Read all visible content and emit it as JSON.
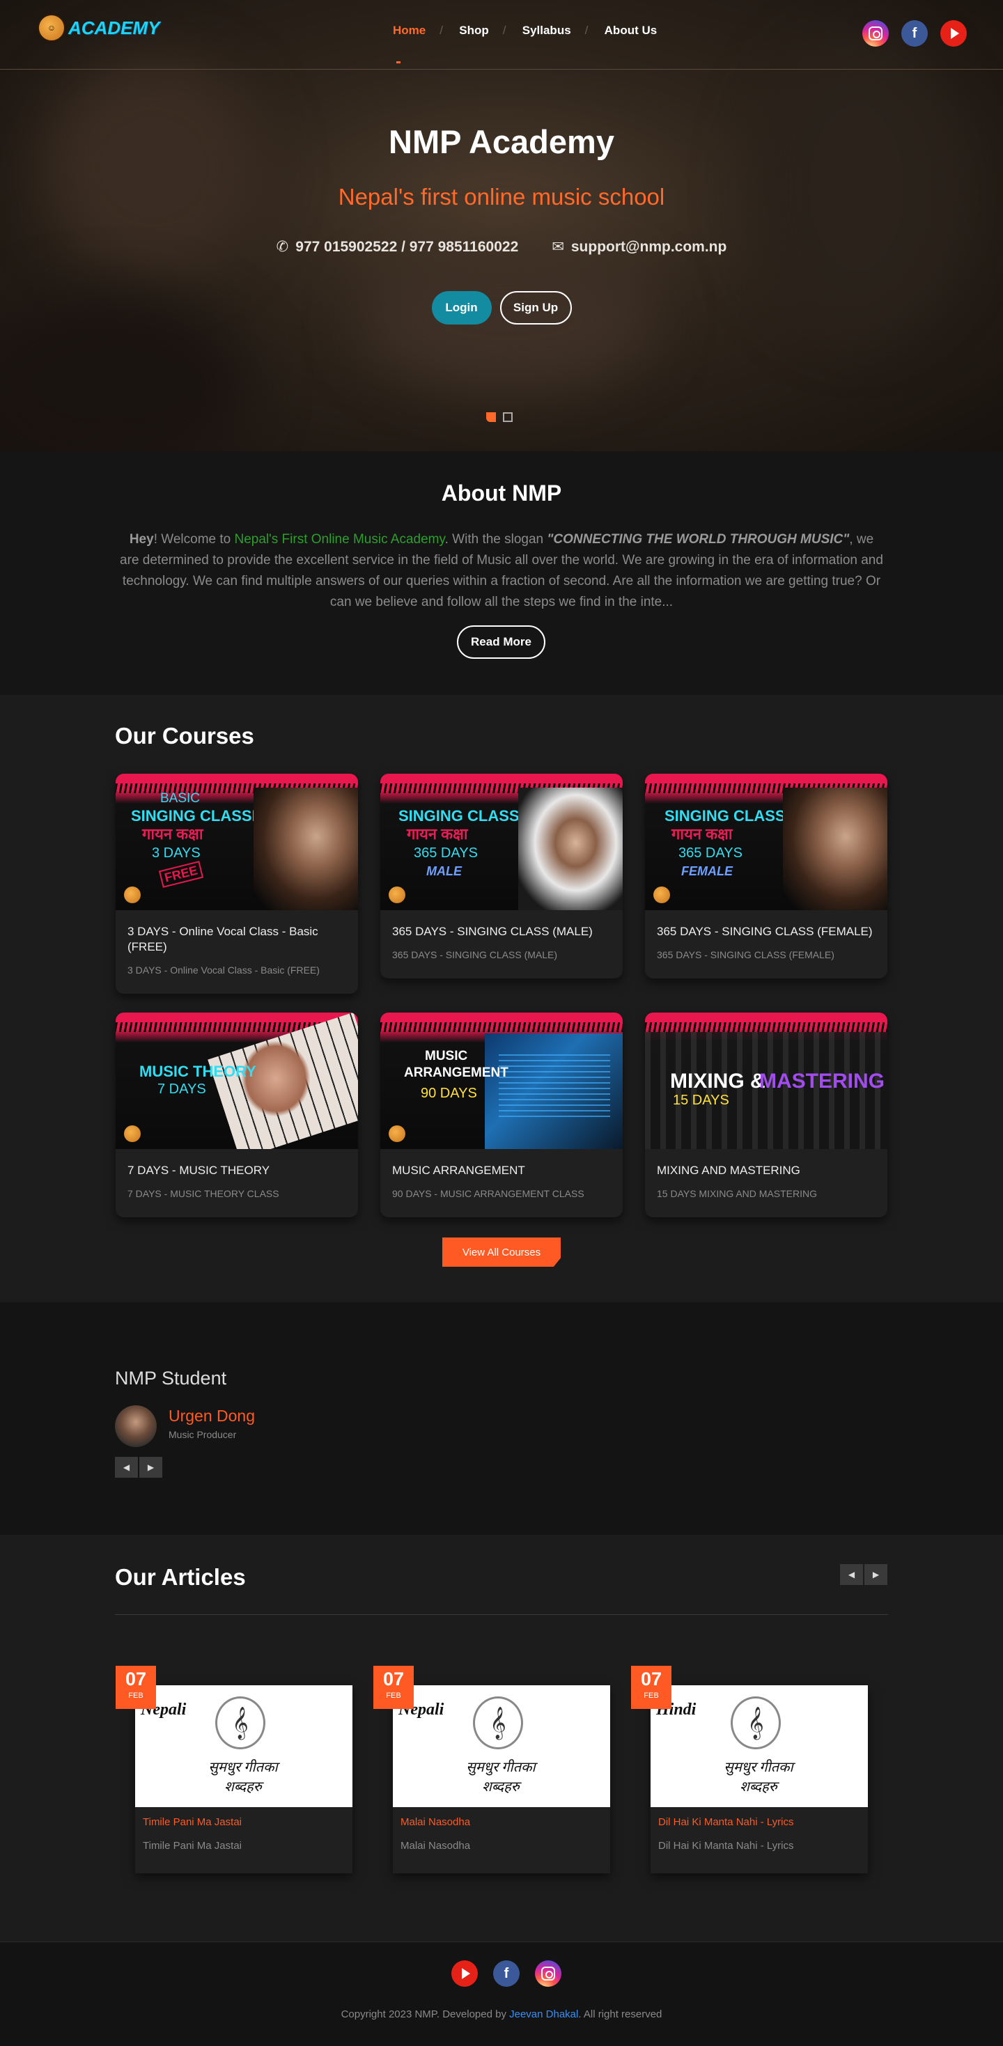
{
  "header": {
    "logo_text": "ACADEMY",
    "nav": [
      {
        "label": "Home",
        "active": true
      },
      {
        "label": "Shop",
        "active": false
      },
      {
        "label": "Syllabus",
        "active": false
      },
      {
        "label": "About Us",
        "active": false
      }
    ],
    "social_icons": [
      "instagram-icon",
      "facebook-icon",
      "youtube-icon"
    ]
  },
  "hero": {
    "title": "NMP Academy",
    "subtitle": "Nepal's first online music school",
    "phone": "977 015902522 / 977 9851160022",
    "email": "support@nmp.com.np",
    "login_label": "Login",
    "signup_label": "Sign Up"
  },
  "about": {
    "heading": "About NMP",
    "hey": "Hey",
    "intro": "! Welcome to ",
    "green_text": "Nepal's First Online Music Academy",
    "mid_text": ". With the slogan ",
    "slogan": "\"CONNECTING THE WORLD THROUGH MUSIC\"",
    "rest_text": ", we are determined to provide the excellent service in the field of Music all over the world. We are growing in the era of information and technology. We can find multiple answers of our queries within a fraction of second. Are all the information we are getting true? Or can we believe and follow all the steps we find in the inte...",
    "read_more_label": "Read More"
  },
  "courses": {
    "heading": "Our Courses",
    "items": [
      {
        "thumb_l1": "BASIC",
        "thumb_l2": "SINGING CLASSES",
        "thumb_l3": "गायन कक्षा",
        "thumb_l4": "3 DAYS",
        "thumb_badge": "FREE",
        "title": "3 DAYS - Online Vocal Class - Basic (FREE)",
        "desc": "3 DAYS - Online Vocal Class - Basic (FREE)"
      },
      {
        "thumb_l1": "SINGING CLASSES",
        "thumb_l2": "गायन कक्षा",
        "thumb_l3": "365 DAYS",
        "thumb_l4": "MALE",
        "title": "365 DAYS - SINGING CLASS (MALE)",
        "desc": "365 DAYS - SINGING CLASS (MALE)"
      },
      {
        "thumb_l1": "SINGING CLASSES",
        "thumb_l2": "गायन कक्षा",
        "thumb_l3": "365 DAYS",
        "thumb_l4": "FEMALE",
        "title": "365 DAYS - SINGING CLASS (FEMALE)",
        "desc": "365 DAYS - SINGING CLASS (FEMALE)"
      },
      {
        "thumb_l1": "MUSIC THEORY",
        "thumb_l2": "7 DAYS",
        "title": "7 DAYS - MUSIC THEORY",
        "desc": "7 DAYS - MUSIC THEORY CLASS"
      },
      {
        "thumb_l1": "MUSIC",
        "thumb_l2": "ARRANGEMENT",
        "thumb_l3": "90 DAYS",
        "title": "MUSIC ARRANGEMENT",
        "desc": "90 DAYS - MUSIC ARRANGEMENT CLASS"
      },
      {
        "thumb_l1": "MIXING &",
        "thumb_l2": "MASTERING",
        "thumb_l3": "15 DAYS",
        "title": "MIXING AND MASTERING",
        "desc": "15 DAYS MIXING AND MASTERING"
      }
    ],
    "view_all_label": "View All Courses"
  },
  "student": {
    "heading": "NMP Student",
    "name": "Urgen Dong",
    "role": "Music Producer"
  },
  "articles": {
    "heading": "Our Articles",
    "items": [
      {
        "day": "07",
        "month": "FEB",
        "lang": "Nepali",
        "script": "सुमधुर गीतका शब्दहरु",
        "title": "Timile Pani Ma Jastai",
        "desc": "Timile Pani Ma Jastai"
      },
      {
        "day": "07",
        "month": "FEB",
        "lang": "Nepali",
        "script": "सुमधुर गीतका शब्दहरु",
        "title": "Malai Nasodha",
        "desc": "Malai Nasodha"
      },
      {
        "day": "07",
        "month": "FEB",
        "lang": "Hindi",
        "script": "सुमधुर गीतका शब्दहरु",
        "title": "Dil Hai Ki Manta Nahi - Lyrics",
        "desc": "Dil Hai Ki Manta Nahi - Lyrics"
      }
    ]
  },
  "footer": {
    "copy_prefix": "Copyright 2023 NMP. Developed by ",
    "developer": "Jeevan Dhakal",
    "copy_suffix": ". All right reserved"
  }
}
